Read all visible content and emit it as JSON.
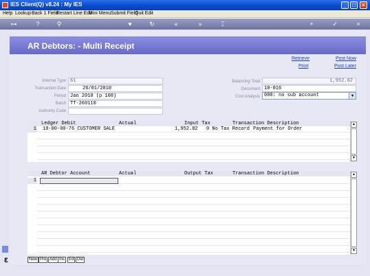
{
  "window": {
    "title": "IES Client(Q) v8.24 : My IES"
  },
  "menu": {
    "items": [
      "Help",
      "Lookup",
      "Back 1 Field",
      "Restart Line Edit",
      "Mini Menu",
      "Submit Field",
      "Quit Edit"
    ]
  },
  "toolbar": {
    "icons": [
      "key-icon",
      "help-icon",
      "search-icon",
      "heart-icon",
      "refresh-icon",
      "rewind-icon",
      "fast-forward-icon",
      "bookmark-icon",
      "add-icon",
      "check-icon",
      "close-icon"
    ]
  },
  "page": {
    "title": "AR Debtors: - Multi Receipt",
    "links": {
      "retrieve": "Retrieve",
      "print": "Print",
      "post_now": "Post Now",
      "post_later": "Post Later"
    }
  },
  "form": {
    "internal_type_label": "Internal Type",
    "internal_type_value": "61",
    "transaction_date_label": "Transaction Date",
    "transaction_date_value": "26/01/2010",
    "period_label": "Period",
    "period_value": "Jan 2010 (p 108)",
    "batch_label": "Batch",
    "batch_value": "TT-260110",
    "authority_code_label": "Authority Code",
    "authority_code_value": "",
    "balancing_total_label": "Balancing Total",
    "balancing_total_value": "1,952.82",
    "document_label": "Document",
    "document_value": "10-016",
    "cost_analysis_label": "Cost Analysis",
    "cost_analysis_value": "000: no sub account"
  },
  "ledger_grid": {
    "columns": [
      "Ledger Debit",
      "Actual",
      "Input Tax",
      "Transaction Description"
    ],
    "rows": [
      {
        "num": "1",
        "account": "10-00-00-76 CUSTOMER SALE",
        "actual": "1,952.82",
        "tax": "0 No Tax Record",
        "description": "Payment for Order"
      }
    ]
  },
  "debtor_grid": {
    "columns": [
      "AR Debtor Account",
      "Actual",
      "Output Tax",
      "Transaction Description"
    ],
    "rows": [
      {
        "num": "1",
        "account": "",
        "actual": "",
        "tax": "",
        "description": ""
      }
    ]
  },
  "bottom_tabs": [
    "New",
    "Pre",
    "Add",
    "Ins",
    "Ed",
    "Del"
  ]
}
